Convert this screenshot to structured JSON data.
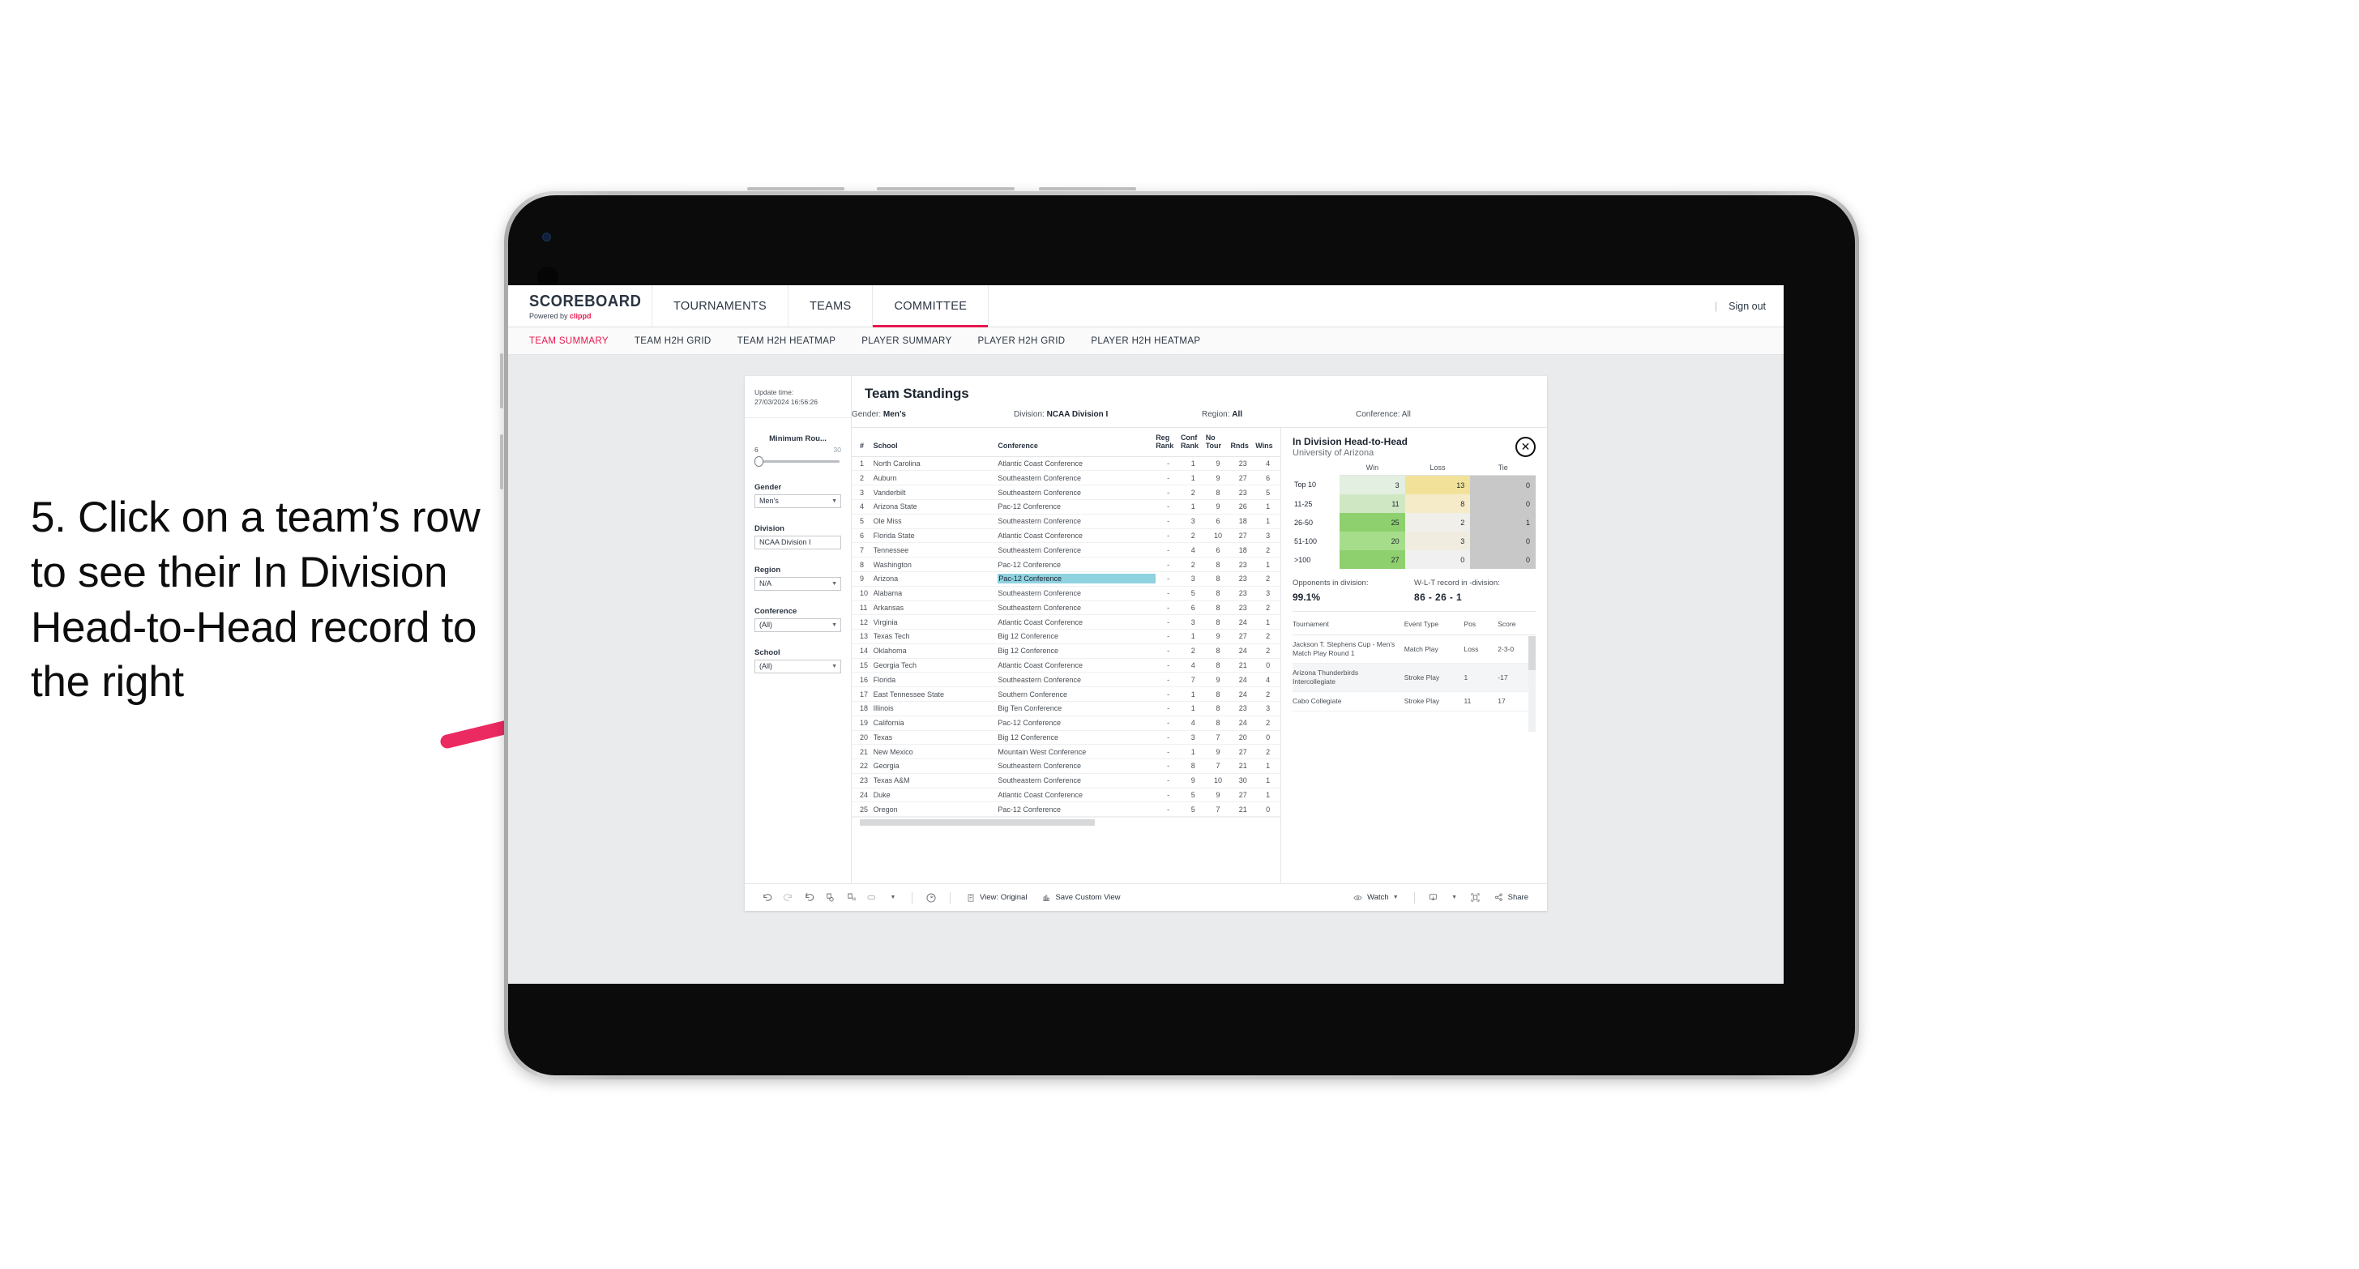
{
  "caption": {
    "text": "5. Click on a team’s row to see their In Division Head-to-Head record to the right"
  },
  "topnav": {
    "brand_title": "SCOREBOARD",
    "brand_sub_prefix": "Powered by ",
    "brand_sub_name": "clippd",
    "items": [
      {
        "label": "TOURNAMENTS",
        "active": false
      },
      {
        "label": "TEAMS",
        "active": false
      },
      {
        "label": "COMMITTEE",
        "active": true
      }
    ],
    "divider": "|",
    "signout": "Sign out"
  },
  "subnav": {
    "tabs": [
      {
        "label": "TEAM SUMMARY",
        "active": true
      },
      {
        "label": "TEAM H2H GRID",
        "active": false
      },
      {
        "label": "TEAM H2H HEATMAP",
        "active": false
      },
      {
        "label": "PLAYER SUMMARY",
        "active": false
      },
      {
        "label": "PLAYER H2H GRID",
        "active": false
      },
      {
        "label": "PLAYER H2H HEATMAP",
        "active": false
      }
    ]
  },
  "filters": {
    "update_label": "Update time:",
    "update_value": "27/03/2024 16:56:26",
    "min_rounds": {
      "label": "Minimum Rou...",
      "min": "6",
      "max": "30",
      "value": 6
    },
    "gender": {
      "label": "Gender",
      "value": "Men’s"
    },
    "division": {
      "label": "Division",
      "value": "NCAA Division I"
    },
    "region": {
      "label": "Region",
      "value": "N/A"
    },
    "conference": {
      "label": "Conference",
      "value": "(All)"
    },
    "school": {
      "label": "School",
      "value": "(All)"
    }
  },
  "standings": {
    "title": "Team Standings",
    "meta": {
      "gender_label": "Gender: ",
      "gender_value": "Men’s",
      "division_label": "Division: ",
      "division_value": "NCAA Division I",
      "region_label": "Region: ",
      "region_value": "All",
      "conference_label": "Conference: ",
      "conference_value": "All"
    },
    "columns": [
      "#",
      "School",
      "Conference",
      "Reg Rank",
      "Conf Rank",
      "No Tour",
      "Rnds",
      "Wins"
    ],
    "rows": [
      {
        "rank": "1",
        "school": "North Carolina",
        "conference": "Atlantic Coast Conference",
        "reg": "-",
        "conf": "1",
        "notour": "9",
        "rnds": "23",
        "wins": "4",
        "highlight": false
      },
      {
        "rank": "2",
        "school": "Auburn",
        "conference": "Southeastern Conference",
        "reg": "-",
        "conf": "1",
        "notour": "9",
        "rnds": "27",
        "wins": "6",
        "highlight": false
      },
      {
        "rank": "3",
        "school": "Vanderbilt",
        "conference": "Southeastern Conference",
        "reg": "-",
        "conf": "2",
        "notour": "8",
        "rnds": "23",
        "wins": "5",
        "highlight": false
      },
      {
        "rank": "4",
        "school": "Arizona State",
        "conference": "Pac-12 Conference",
        "reg": "-",
        "conf": "1",
        "notour": "9",
        "rnds": "26",
        "wins": "1",
        "highlight": false
      },
      {
        "rank": "5",
        "school": "Ole Miss",
        "conference": "Southeastern Conference",
        "reg": "-",
        "conf": "3",
        "notour": "6",
        "rnds": "18",
        "wins": "1",
        "highlight": false
      },
      {
        "rank": "6",
        "school": "Florida State",
        "conference": "Atlantic Coast Conference",
        "reg": "-",
        "conf": "2",
        "notour": "10",
        "rnds": "27",
        "wins": "3",
        "highlight": false
      },
      {
        "rank": "7",
        "school": "Tennessee",
        "conference": "Southeastern Conference",
        "reg": "-",
        "conf": "4",
        "notour": "6",
        "rnds": "18",
        "wins": "2",
        "highlight": false
      },
      {
        "rank": "8",
        "school": "Washington",
        "conference": "Pac-12 Conference",
        "reg": "-",
        "conf": "2",
        "notour": "8",
        "rnds": "23",
        "wins": "1",
        "highlight": false
      },
      {
        "rank": "9",
        "school": "Arizona",
        "conference": "Pac-12 Conference",
        "reg": "-",
        "conf": "3",
        "notour": "8",
        "rnds": "23",
        "wins": "2",
        "highlight": true
      },
      {
        "rank": "10",
        "school": "Alabama",
        "conference": "Southeastern Conference",
        "reg": "-",
        "conf": "5",
        "notour": "8",
        "rnds": "23",
        "wins": "3",
        "highlight": false
      },
      {
        "rank": "11",
        "school": "Arkansas",
        "conference": "Southeastern Conference",
        "reg": "-",
        "conf": "6",
        "notour": "8",
        "rnds": "23",
        "wins": "2",
        "highlight": false
      },
      {
        "rank": "12",
        "school": "Virginia",
        "conference": "Atlantic Coast Conference",
        "reg": "-",
        "conf": "3",
        "notour": "8",
        "rnds": "24",
        "wins": "1",
        "highlight": false
      },
      {
        "rank": "13",
        "school": "Texas Tech",
        "conference": "Big 12 Conference",
        "reg": "-",
        "conf": "1",
        "notour": "9",
        "rnds": "27",
        "wins": "2",
        "highlight": false
      },
      {
        "rank": "14",
        "school": "Oklahoma",
        "conference": "Big 12 Conference",
        "reg": "-",
        "conf": "2",
        "notour": "8",
        "rnds": "24",
        "wins": "2",
        "highlight": false
      },
      {
        "rank": "15",
        "school": "Georgia Tech",
        "conference": "Atlantic Coast Conference",
        "reg": "-",
        "conf": "4",
        "notour": "8",
        "rnds": "21",
        "wins": "0",
        "highlight": false
      },
      {
        "rank": "16",
        "school": "Florida",
        "conference": "Southeastern Conference",
        "reg": "-",
        "conf": "7",
        "notour": "9",
        "rnds": "24",
        "wins": "4",
        "highlight": false
      },
      {
        "rank": "17",
        "school": "East Tennessee State",
        "conference": "Southern Conference",
        "reg": "-",
        "conf": "1",
        "notour": "8",
        "rnds": "24",
        "wins": "2",
        "highlight": false
      },
      {
        "rank": "18",
        "school": "Illinois",
        "conference": "Big Ten Conference",
        "reg": "-",
        "conf": "1",
        "notour": "8",
        "rnds": "23",
        "wins": "3",
        "highlight": false
      },
      {
        "rank": "19",
        "school": "California",
        "conference": "Pac-12 Conference",
        "reg": "-",
        "conf": "4",
        "notour": "8",
        "rnds": "24",
        "wins": "2",
        "highlight": false
      },
      {
        "rank": "20",
        "school": "Texas",
        "conference": "Big 12 Conference",
        "reg": "-",
        "conf": "3",
        "notour": "7",
        "rnds": "20",
        "wins": "0",
        "highlight": false
      },
      {
        "rank": "21",
        "school": "New Mexico",
        "conference": "Mountain West Conference",
        "reg": "-",
        "conf": "1",
        "notour": "9",
        "rnds": "27",
        "wins": "2",
        "highlight": false
      },
      {
        "rank": "22",
        "school": "Georgia",
        "conference": "Southeastern Conference",
        "reg": "-",
        "conf": "8",
        "notour": "7",
        "rnds": "21",
        "wins": "1",
        "highlight": false
      },
      {
        "rank": "23",
        "school": "Texas A&M",
        "conference": "Southeastern Conference",
        "reg": "-",
        "conf": "9",
        "notour": "10",
        "rnds": "30",
        "wins": "1",
        "highlight": false
      },
      {
        "rank": "24",
        "school": "Duke",
        "conference": "Atlantic Coast Conference",
        "reg": "-",
        "conf": "5",
        "notour": "9",
        "rnds": "27",
        "wins": "1",
        "highlight": false
      },
      {
        "rank": "25",
        "school": "Oregon",
        "conference": "Pac-12 Conference",
        "reg": "-",
        "conf": "5",
        "notour": "7",
        "rnds": "21",
        "wins": "0",
        "highlight": false
      }
    ]
  },
  "h2h": {
    "title": "In Division Head-to-Head",
    "subtitle": "University of Arizona",
    "close_icon": "✕",
    "columns": [
      "",
      "Win",
      "Loss",
      "Tie"
    ],
    "rows": [
      {
        "label": "Top 10",
        "win": "3",
        "loss": "13",
        "tie": "0",
        "win_color": "#e3efe1",
        "loss_color": "#f2e299",
        "tie_color": "#c8c8c8"
      },
      {
        "label": "11-25",
        "win": "11",
        "loss": "8",
        "tie": "0",
        "win_color": "#cfe7c2",
        "loss_color": "#f5ebc8",
        "tie_color": "#c8c8c8"
      },
      {
        "label": "26-50",
        "win": "25",
        "loss": "2",
        "tie": "1",
        "win_color": "#8ed06e",
        "loss_color": "#f0efea",
        "tie_color": "#c8c8c8"
      },
      {
        "label": "51-100",
        "win": "20",
        "loss": "3",
        "tie": "0",
        "win_color": "#a6dd8a",
        "loss_color": "#f0ecdf",
        "tie_color": "#c8c8c8"
      },
      {
        "label": ">100",
        "win": "27",
        "loss": "0",
        "tie": "0",
        "win_color": "#8ed06e",
        "loss_color": "#f0f0f0",
        "tie_color": "#c8c8c8"
      }
    ],
    "stats": [
      {
        "label": "Opponents in division:",
        "value": "99.1%"
      },
      {
        "label": "W-L-T record in -division:",
        "value": "86 - 26 - 1"
      }
    ],
    "tournaments": {
      "columns": [
        "Tournament",
        "Event Type",
        "Pos",
        "Score"
      ],
      "rows": [
        {
          "name": "Jackson T. Stephens Cup - Men’s Match Play Round 1",
          "type": "Match Play",
          "pos": "Loss",
          "score": "2-3-0"
        },
        {
          "name": "Arizona Thunderbirds Intercollegiate",
          "type": "Stroke Play",
          "pos": "1",
          "score": "-17"
        },
        {
          "name": "Cabo Collegiate",
          "type": "Stroke Play",
          "pos": "11",
          "score": "17"
        }
      ]
    }
  },
  "toolbar": {
    "icons": [
      "undo-icon",
      "redo-icon",
      "revert-icon",
      "refresh-data-icon",
      "pause-auto-update-icon",
      "device-layout-icon"
    ],
    "view_label": "View: Original",
    "save_label": "Save Custom View",
    "watch_label": "Watch",
    "share_label": "Share"
  },
  "colors": {
    "accent": "#e8174e",
    "highlight_row": "#8fd2e0",
    "arrow": "#ec2a62"
  }
}
